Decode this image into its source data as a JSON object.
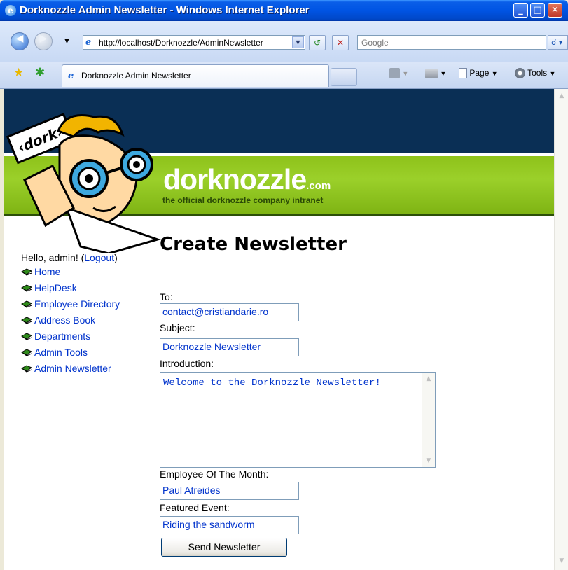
{
  "window": {
    "title": "Dorknozzle Admin Newsletter - Windows Internet Explorer",
    "minimize": "_",
    "maximize": "□",
    "close": "✕"
  },
  "address_bar": {
    "url": "http://localhost/Dorknozzle/AdminNewsletter",
    "search_placeholder": "Google"
  },
  "tab": {
    "label": "Dorknozzle Admin Newsletter"
  },
  "toolbar": {
    "page_label": "Page",
    "tools_label": "Tools"
  },
  "banner": {
    "logo_sign": "‹dork›",
    "brand": "dorknozzle",
    "brand_suffix": ".com",
    "tagline": "the official dorknozzle company intranet"
  },
  "sidebar": {
    "greeting": "Hello, admin! (",
    "logout": "Logout",
    "greeting_end": ")",
    "items": [
      {
        "label": "Home"
      },
      {
        "label": "HelpDesk"
      },
      {
        "label": "Employee Directory"
      },
      {
        "label": "Address Book"
      },
      {
        "label": "Departments"
      },
      {
        "label": "Admin Tools"
      },
      {
        "label": "Admin Newsletter"
      }
    ]
  },
  "form": {
    "title": "Create Newsletter",
    "to_label": "To:",
    "to_value": "contact@cristiandarie.ro",
    "subject_label": "Subject:",
    "subject_value": "Dorknozzle Newsletter",
    "intro_label": "Introduction:",
    "intro_value": "Welcome to the Dorknozzle Newsletter!",
    "employee_label": "Employee Of The Month:",
    "employee_value": "Paul Atreides",
    "event_label": "Featured Event:",
    "event_value": "Riding the sandworm",
    "send_button": "Send Newsletter"
  }
}
